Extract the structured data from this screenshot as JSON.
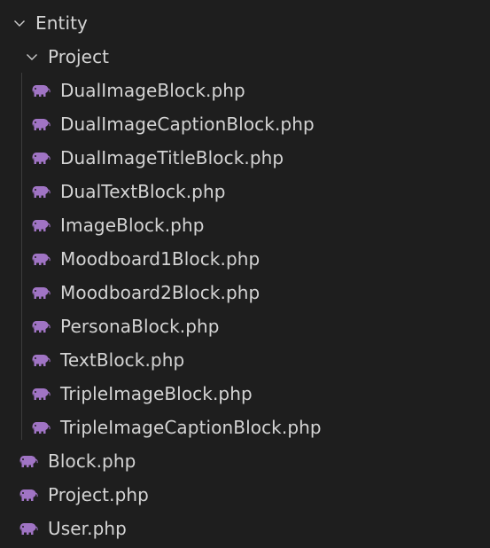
{
  "colors": {
    "background": "#1e1e1e",
    "text": "#d4d4d4",
    "php_icon": "#a074c4",
    "chevron": "#cccccc"
  },
  "tree": {
    "entity_folder": {
      "label": "Entity",
      "icon": "chevron-down-icon",
      "expanded": true
    },
    "project_folder": {
      "label": "Project",
      "icon": "chevron-down-icon",
      "expanded": true
    },
    "project_files": [
      {
        "label": "DualImageBlock.php",
        "icon": "php-elephant-icon"
      },
      {
        "label": "DualImageCaptionBlock.php",
        "icon": "php-elephant-icon"
      },
      {
        "label": "DualImageTitleBlock.php",
        "icon": "php-elephant-icon"
      },
      {
        "label": "DualTextBlock.php",
        "icon": "php-elephant-icon"
      },
      {
        "label": "ImageBlock.php",
        "icon": "php-elephant-icon"
      },
      {
        "label": "Moodboard1Block.php",
        "icon": "php-elephant-icon"
      },
      {
        "label": "Moodboard2Block.php",
        "icon": "php-elephant-icon"
      },
      {
        "label": "PersonaBlock.php",
        "icon": "php-elephant-icon"
      },
      {
        "label": "TextBlock.php",
        "icon": "php-elephant-icon"
      },
      {
        "label": "TripleImageBlock.php",
        "icon": "php-elephant-icon"
      },
      {
        "label": "TripleImageCaptionBlock.php",
        "icon": "php-elephant-icon"
      }
    ],
    "entity_files": [
      {
        "label": "Block.php",
        "icon": "php-elephant-icon"
      },
      {
        "label": "Project.php",
        "icon": "php-elephant-icon"
      },
      {
        "label": "User.php",
        "icon": "php-elephant-icon"
      }
    ]
  }
}
